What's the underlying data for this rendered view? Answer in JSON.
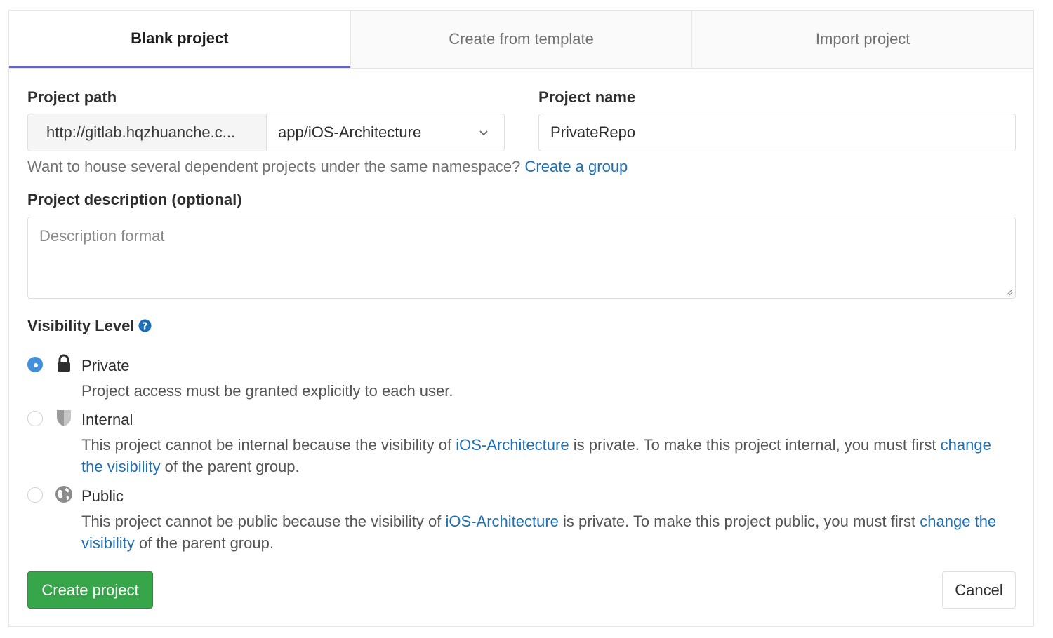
{
  "tabs": [
    {
      "label": "Blank project",
      "active": true
    },
    {
      "label": "Create from template",
      "active": false
    },
    {
      "label": "Import project",
      "active": false
    }
  ],
  "project_path": {
    "label": "Project path",
    "prefix": "http://gitlab.hqzhuanche.c...",
    "namespace": "app/iOS-Architecture"
  },
  "project_name": {
    "label": "Project name",
    "value": "PrivateRepo"
  },
  "hint": {
    "text": "Want to house several dependent projects under the same namespace?",
    "link": "Create a group"
  },
  "description": {
    "label": "Project description (optional)",
    "placeholder": "Description format"
  },
  "visibility": {
    "label": "Visibility Level",
    "options": [
      {
        "title": "Private",
        "selected": true,
        "icon": "lock-icon",
        "desc": "Project access must be granted explicitly to each user."
      },
      {
        "title": "Internal",
        "selected": false,
        "icon": "shield-icon",
        "desc_pre": "This project cannot be internal because the visibility of",
        "desc_link1": "iOS-Architecture",
        "desc_mid": "is private. To make this project internal, you must first",
        "desc_link2": "change the visibility",
        "desc_post": "of the parent group."
      },
      {
        "title": "Public",
        "selected": false,
        "icon": "globe-icon",
        "desc_pre": "This project cannot be public because the visibility of",
        "desc_link1": "iOS-Architecture",
        "desc_mid": "is private. To make this project public, you must first",
        "desc_link2": "change the visibility",
        "desc_post": "of the parent group."
      }
    ]
  },
  "buttons": {
    "create": "Create project",
    "cancel": "Cancel"
  },
  "colors": {
    "accent": "#428fdc",
    "link": "#1f6fb4",
    "primary_button": "#37a64a",
    "active_tab_underline": "#6666c4"
  }
}
